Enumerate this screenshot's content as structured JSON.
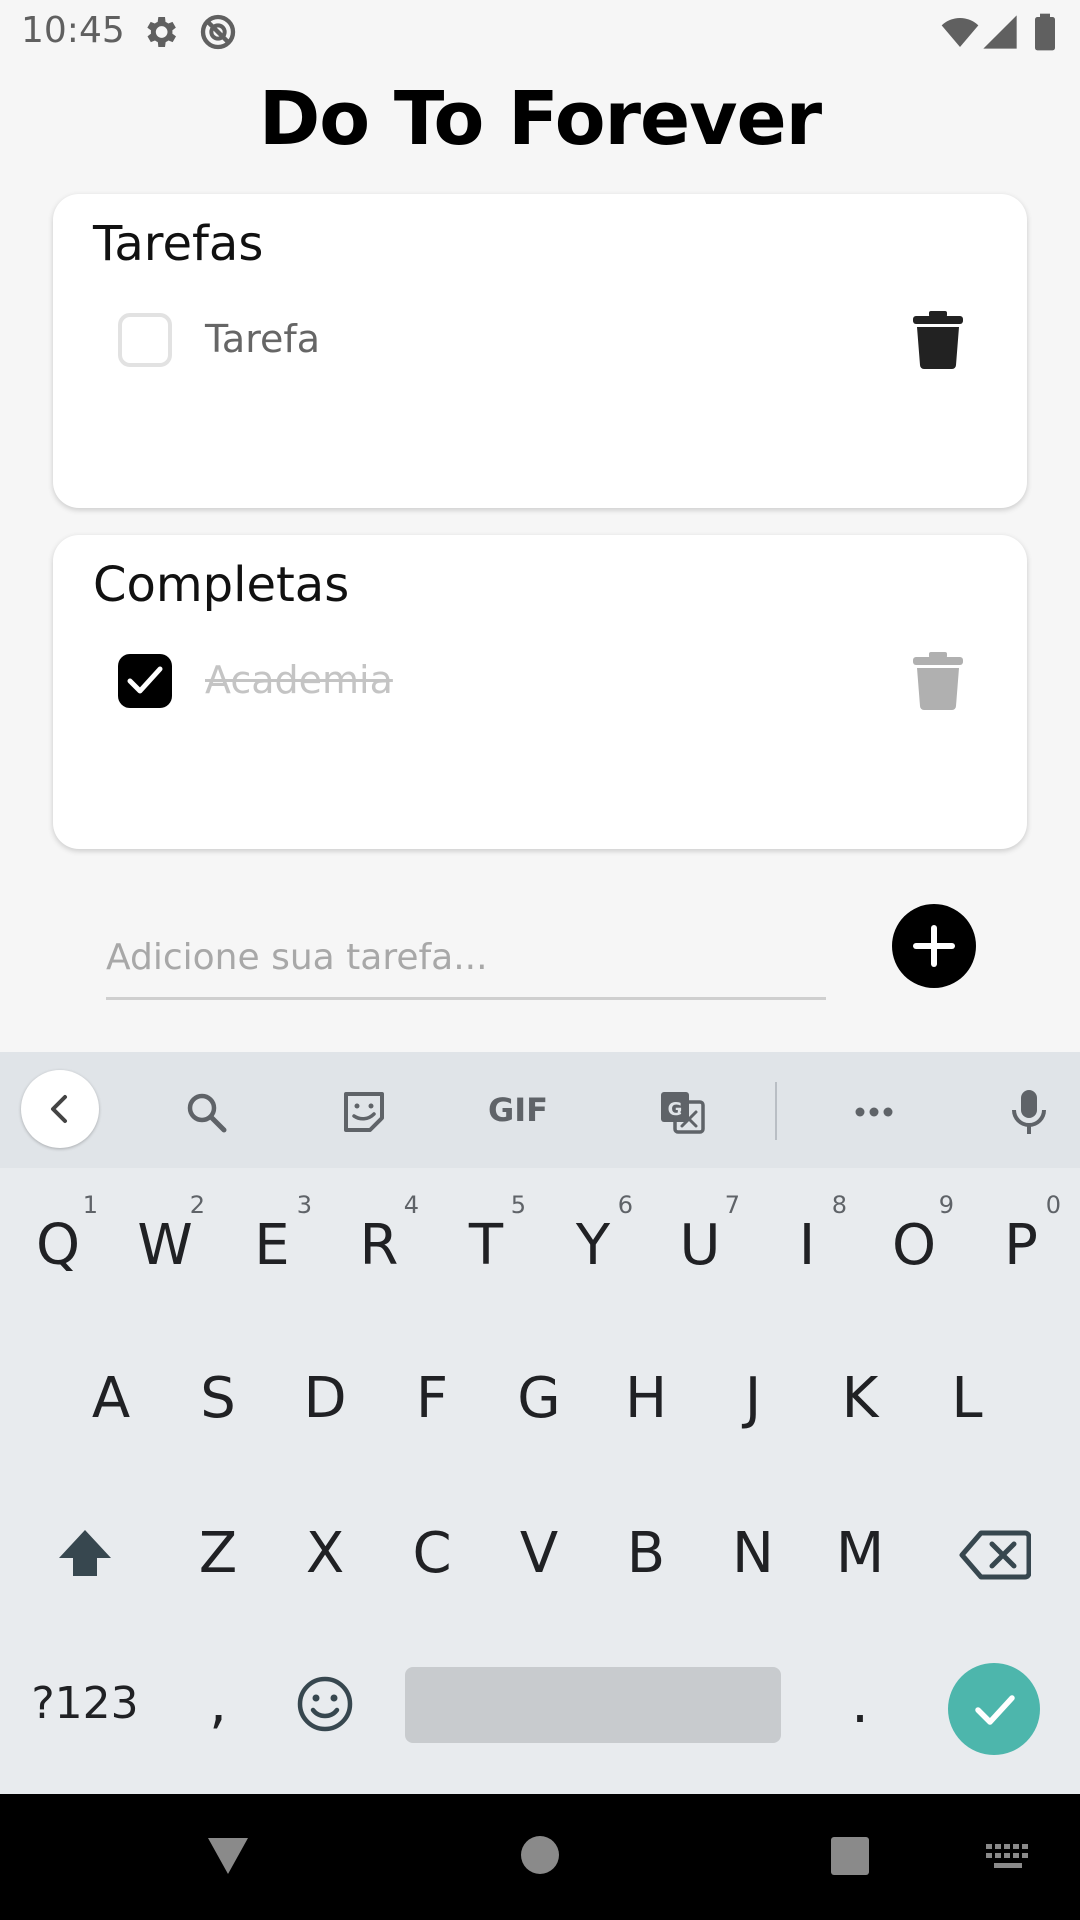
{
  "status_bar": {
    "time": "10:45",
    "icons": [
      "gear-icon",
      "no-sync-icon",
      "wifi-icon",
      "signal-icon",
      "battery-icon"
    ]
  },
  "app": {
    "title": "Do To Forever"
  },
  "todo_card": {
    "title": "Tarefas",
    "tasks": [
      {
        "text": "Tarefa",
        "checked": false
      }
    ]
  },
  "done_card": {
    "title": "Completas",
    "tasks": [
      {
        "text": "Academia",
        "checked": true
      }
    ]
  },
  "add_task": {
    "placeholder": "Adicione sua tarefa...",
    "value": ""
  },
  "keyboard": {
    "toolbar_icons": [
      "back-icon",
      "search-icon",
      "sticker-icon",
      "gif-icon",
      "translate-icon",
      "more-icon",
      "mic-icon"
    ],
    "gif_label": "GIF",
    "row1": [
      "Q",
      "W",
      "E",
      "R",
      "T",
      "Y",
      "U",
      "I",
      "O",
      "P"
    ],
    "row1_hints": [
      "1",
      "2",
      "3",
      "4",
      "5",
      "6",
      "7",
      "8",
      "9",
      "0"
    ],
    "row2": [
      "A",
      "S",
      "D",
      "F",
      "G",
      "H",
      "J",
      "K",
      "L"
    ],
    "row3": [
      "Z",
      "X",
      "C",
      "V",
      "B",
      "N",
      "M"
    ],
    "symbols_label": "?123",
    "comma_label": ",",
    "period_label": "."
  },
  "colors": {
    "background": "#f6f6f6",
    "card": "#ffffff",
    "accent_enter": "#4db6ac",
    "keyboard_bg": "#e8ebee",
    "done_text": "#c4c4c4"
  }
}
